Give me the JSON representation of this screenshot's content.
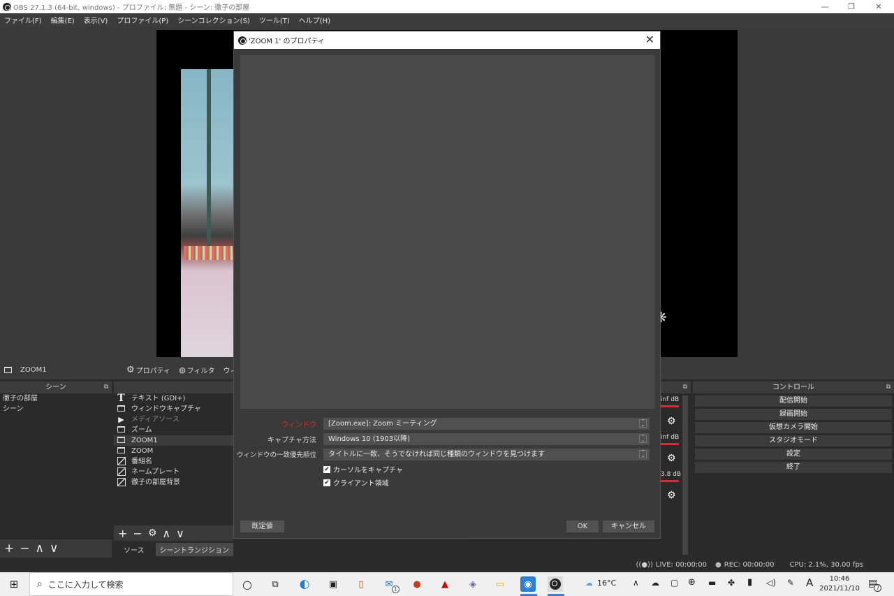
{
  "window": {
    "title": "OBS 27.1.3 (64-bit, windows) - プロファイル: 無題 - シーン: 徹子の部屋",
    "minimize": "—",
    "maximize": "❐",
    "close": "✕"
  },
  "menu": [
    "ファイル(F)",
    "編集(E)",
    "表示(V)",
    "プロファイル(P)",
    "シーンコレクション(S)",
    "ツール(T)",
    "ヘルプ(H)"
  ],
  "source_bar": {
    "selected": "ZOOM1",
    "properties": "プロパティ",
    "filters": "フィルタ",
    "window": "ウィンド"
  },
  "scenes": {
    "title": "シーン",
    "items": [
      "徹子の部屋",
      "シーン"
    ]
  },
  "sources": {
    "items": [
      {
        "label": "テキスト (GDI+)",
        "icon": "text-icon",
        "dim": false
      },
      {
        "label": "ウィンドウキャプチャ",
        "icon": "window-icon",
        "dim": false
      },
      {
        "label": "メディアソース",
        "icon": "play-icon",
        "dim": true
      },
      {
        "label": "ズーム",
        "icon": "window-icon",
        "dim": false
      },
      {
        "label": "ZOOM1",
        "icon": "window-icon",
        "dim": false,
        "selected": true
      },
      {
        "label": "ZOOM",
        "icon": "window-icon",
        "dim": false
      },
      {
        "label": "番組名",
        "icon": "image-icon",
        "dim": false
      },
      {
        "label": "ネームプレート",
        "icon": "image-icon",
        "dim": false
      },
      {
        "label": "徹子の部屋背景",
        "icon": "image-icon",
        "dim": false
      }
    ],
    "tabs": [
      "ソース",
      "シーントランジション"
    ]
  },
  "mixer": {
    "levels": [
      "inf dB",
      "inf dB",
      "3.8 dB"
    ]
  },
  "controls": {
    "title": "コントロール",
    "buttons": [
      "配信開始",
      "録画開始",
      "仮想カメラ開始",
      "スタジオモード",
      "設定",
      "終了"
    ]
  },
  "status": {
    "live": "LIVE: 00:00:00",
    "rec": "REC: 00:00:00",
    "cpu": "CPU: 2.1%, 30.00 fps"
  },
  "dialog": {
    "title": "'ZOOM 1' のプロパティ",
    "fields": [
      {
        "label": "ウィンドウ",
        "value": "[Zoom.exe]: Zoom ミーティング",
        "label_color": "#d03030"
      },
      {
        "label": "キャプチャ方法",
        "value": "Windows 10 (1903以降)"
      },
      {
        "label": "ウィンドウの一致優先順位",
        "value": "タイトルに一致、そうでなければ同じ種類のウィンドウを見つけます"
      }
    ],
    "checkboxes": [
      {
        "label": "カーソルをキャプチャ",
        "checked": true
      },
      {
        "label": "クライアント領域",
        "checked": true
      }
    ],
    "defaults": "既定値",
    "ok": "OK",
    "cancel": "キャンセル"
  },
  "taskbar": {
    "search_placeholder": "ここに入力して検索",
    "weather": "16°C",
    "ime": "A",
    "time": "10:46",
    "date": "2021/11/10",
    "notifications": "7",
    "mail_badge": "1"
  }
}
